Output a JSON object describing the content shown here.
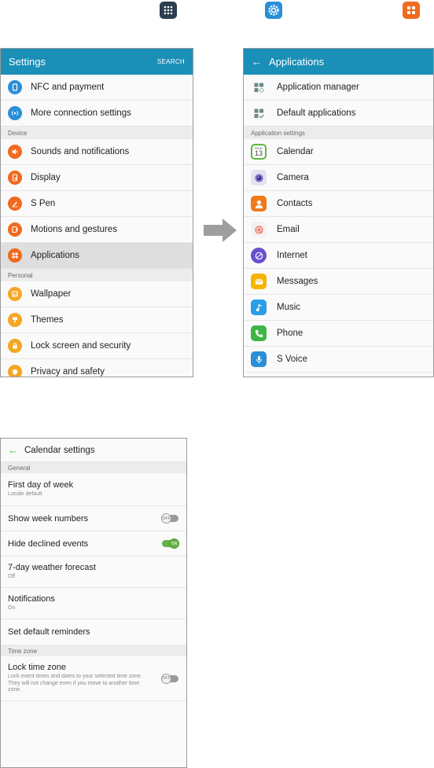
{
  "top_icons": [
    {
      "name": "apps-icon",
      "color": "#2c3e50"
    },
    {
      "name": "settings-gear-icon",
      "color": "#2a8fd8"
    },
    {
      "name": "applications-icon",
      "color": "#f06a1f"
    }
  ],
  "settings_screen": {
    "title": "Settings",
    "search_label": "SEARCH",
    "items": [
      {
        "label": "NFC and payment",
        "icon": "nfc-icon",
        "color": "#2a8fd8"
      },
      {
        "label": "More connection settings",
        "icon": "connection-icon",
        "color": "#2a8fd8"
      }
    ],
    "device_header": "Device",
    "device_items": [
      {
        "label": "Sounds and notifications",
        "icon": "sound-icon",
        "color": "#f06a1f"
      },
      {
        "label": "Display",
        "icon": "display-icon",
        "color": "#f06a1f"
      },
      {
        "label": "S Pen",
        "icon": "pen-icon",
        "color": "#f06a1f"
      },
      {
        "label": "Motions and gestures",
        "icon": "motion-icon",
        "color": "#f06a1f"
      },
      {
        "label": "Applications",
        "icon": "applications-icon",
        "color": "#f06a1f"
      }
    ],
    "personal_header": "Personal",
    "personal_items": [
      {
        "label": "Wallpaper",
        "icon": "wallpaper-icon",
        "color": "#f5a623"
      },
      {
        "label": "Themes",
        "icon": "themes-icon",
        "color": "#f5a623"
      },
      {
        "label": "Lock screen and security",
        "icon": "lock-icon",
        "color": "#f5a623"
      },
      {
        "label": "Privacy and safety",
        "icon": "privacy-icon",
        "color": "#f5a623"
      }
    ]
  },
  "arrow_icon": "right-arrow-icon",
  "applications_screen": {
    "title": "Applications",
    "items": [
      {
        "label": "Application manager",
        "icon": "application-manager-icon"
      },
      {
        "label": "Default applications",
        "icon": "default-applications-icon"
      }
    ],
    "header": "Application settings",
    "apps": [
      {
        "label": "Calendar",
        "icon": "calendar-icon",
        "color": "#5fb83a"
      },
      {
        "label": "Camera",
        "icon": "camera-icon",
        "color": "#7a72c8"
      },
      {
        "label": "Contacts",
        "icon": "contacts-icon",
        "color": "#f07a1a"
      },
      {
        "label": "Email",
        "icon": "email-icon",
        "color": "#e84a3c"
      },
      {
        "label": "Internet",
        "icon": "internet-icon",
        "color": "#6a4fcf"
      },
      {
        "label": "Messages",
        "icon": "messages-icon",
        "color": "#f5b400"
      },
      {
        "label": "Music",
        "icon": "music-icon",
        "color": "#2a9ee8"
      },
      {
        "label": "Phone",
        "icon": "phone-icon",
        "color": "#3fb548"
      },
      {
        "label": "S Voice",
        "icon": "voice-icon",
        "color": "#2a8fd8"
      }
    ],
    "calendar_badge": {
      "month": "MON",
      "day": "13"
    }
  },
  "calendar_settings": {
    "title": "Calendar settings",
    "general_header": "General",
    "first_day": {
      "label": "First day of week",
      "sub": "Locale default"
    },
    "week_numbers": {
      "label": "Show week numbers",
      "state": "OFF"
    },
    "hide_declined": {
      "label": "Hide declined events",
      "state": "ON"
    },
    "weather": {
      "label": "7-day weather forecast",
      "sub": "Off"
    },
    "notifications": {
      "label": "Notifications",
      "sub": "On"
    },
    "reminders": {
      "label": "Set default reminders"
    },
    "timezone_header": "Time zone",
    "lock_tz": {
      "label": "Lock time zone",
      "sub": "Lock event times and dates to your selected time zone. They will not change even if you move to another time zone.",
      "state": "OFF"
    }
  }
}
